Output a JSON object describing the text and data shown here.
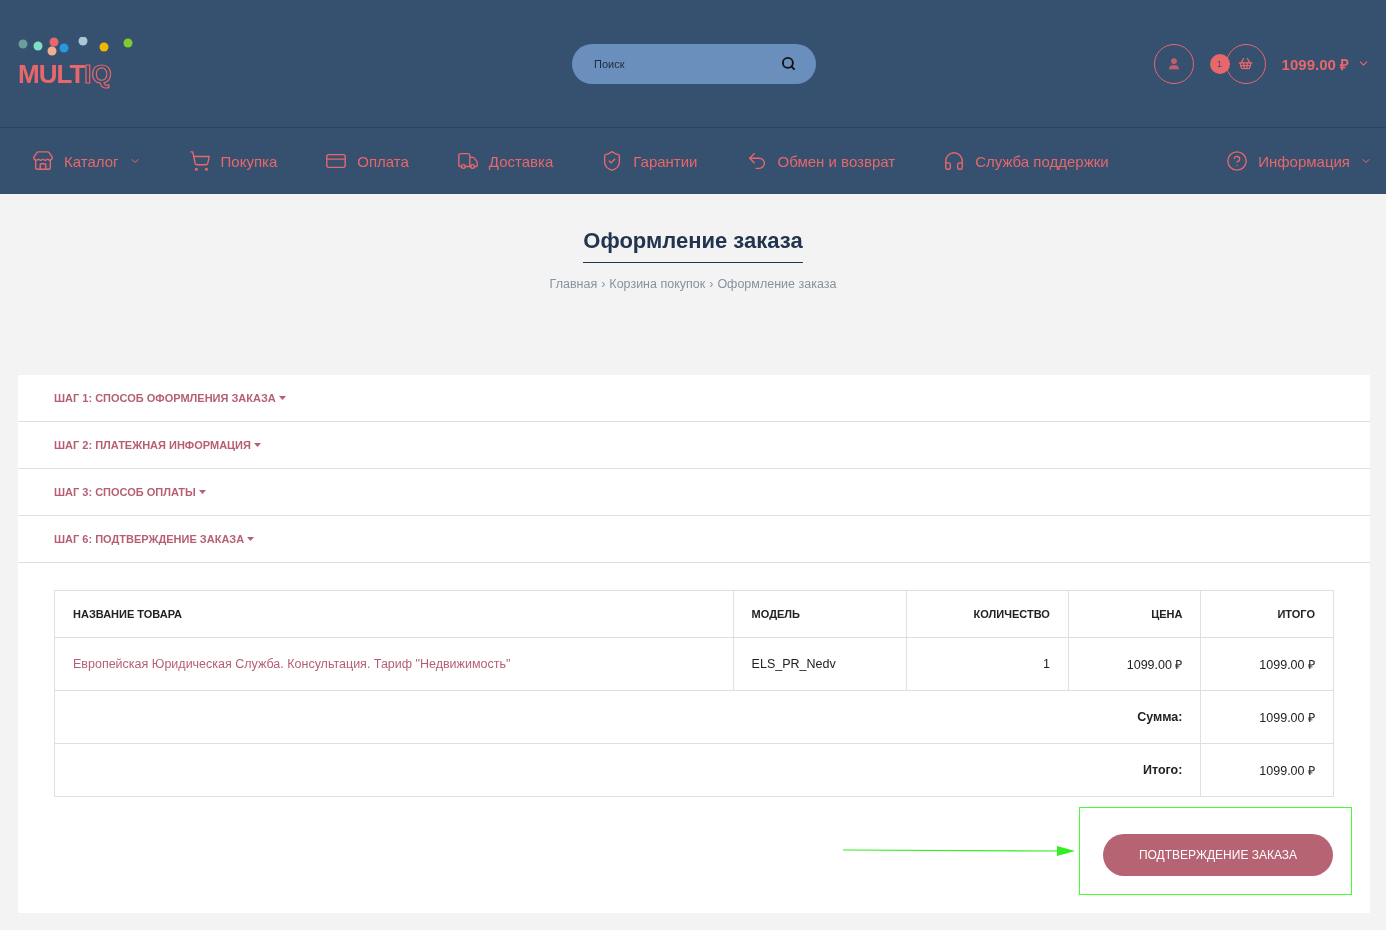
{
  "header": {
    "logo": {
      "bold": "MULT",
      "outline": "IQ"
    },
    "search": {
      "placeholder": "Поиск"
    },
    "cart": {
      "count": "1",
      "total": "1099.00 ₽"
    }
  },
  "nav": [
    {
      "kind": "store",
      "label": "Каталог",
      "dropdown": true
    },
    {
      "kind": "cart",
      "label": "Покупка",
      "dropdown": false
    },
    {
      "kind": "card",
      "label": "Оплата",
      "dropdown": false
    },
    {
      "kind": "truck",
      "label": "Доставка",
      "dropdown": false
    },
    {
      "kind": "shield",
      "label": "Гарантии",
      "dropdown": false
    },
    {
      "kind": "return",
      "label": "Обмен и возврат",
      "dropdown": false
    },
    {
      "kind": "headset",
      "label": "Служба поддержки",
      "dropdown": false
    },
    {
      "kind": "help",
      "label": "Информация",
      "dropdown": true
    }
  ],
  "page": {
    "title": "Оформление заказа",
    "breadcrumbs": [
      "Главная",
      "Корзина покупок",
      "Оформление заказа"
    ],
    "separator": "›"
  },
  "steps": [
    {
      "label": "ШАГ 1: СПОСОБ ОФОРМЛЕНИЯ ЗАКАЗА"
    },
    {
      "label": "ШАГ 2: ПЛАТЕЖНАЯ ИНФОРМАЦИЯ"
    },
    {
      "label": "ШАГ 3: СПОСОБ ОПЛАТЫ"
    },
    {
      "label": "ШАГ 6: ПОДТВЕРЖДЕНИЕ ЗАКАЗА"
    }
  ],
  "table": {
    "columns": [
      "НАЗВАНИЕ ТОВАРА",
      "МОДЕЛЬ",
      "КОЛИЧЕСТВО",
      "ЦЕНА",
      "ИТОГО"
    ],
    "rows": [
      {
        "name": "Европейская Юридическая Служба. Консультация. Тариф \"Недвижимость\"",
        "model": "ELS_PR_Nedv",
        "quantity": "1",
        "price": "1099.00 ₽",
        "total": "1099.00 ₽"
      }
    ],
    "totals": [
      {
        "label": "Сумма:",
        "value": "1099.00 ₽"
      },
      {
        "label": "Итого:",
        "value": "1099.00 ₽"
      }
    ]
  },
  "confirm_button": "ПОДТВЕРЖДЕНИЕ ЗАКАЗА"
}
